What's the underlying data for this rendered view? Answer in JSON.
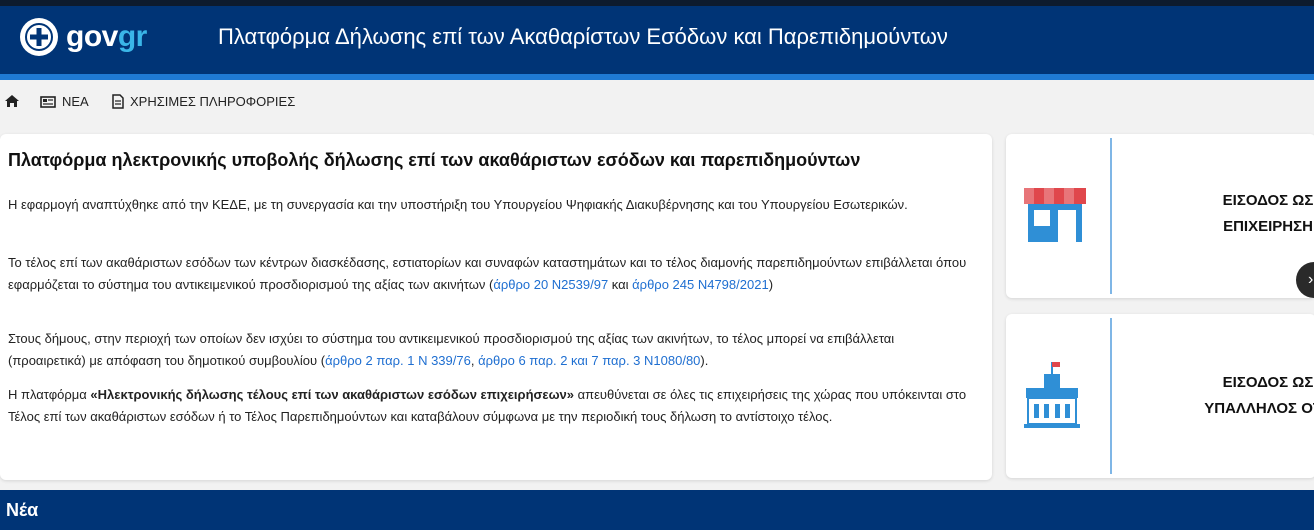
{
  "header": {
    "logo_prefix": "gov",
    "logo_suffix": "gr",
    "title": "Πλατφόρμα Δήλωσης επί των Ακαθαρίστων Εσόδων και Παρεπιδημούντων"
  },
  "nav": {
    "home_icon": "home-icon",
    "news_label": "ΝΕΑ",
    "info_label": "ΧΡΗΣΙΜΕΣ ΠΛΗΡΟΦΟΡΙΕΣ"
  },
  "main": {
    "heading": "Πλατφόρμα ηλεκτρονικής υποβολής δήλωσης επί των ακαθάριστων εσόδων και παρεπιδημούντων",
    "p1": "Η εφαρμογή αναπτύχθηκε από την ΚΕΔΕ, με τη συνεργασία και την υποστήριξη του Υπουργείου Ψηφιακής Διακυβέρνησης και του Υπουργείου Εσωτερικών.",
    "p2_text": "Το τέλος επί των ακαθάριστων εσόδων των κέντρων διασκέδασης, εστιατορίων και συναφών καταστημάτων και το τέλος διαμονής παρεπιδημούντων επιβάλλεται όπου εφαρμόζεται το σύστημα του αντικειμενικού προσδιορισμού της αξίας των ακινήτων (",
    "p2_link1": "άρθρο 20 Ν2539/97",
    "p2_mid": " και ",
    "p2_link2": "άρθρο 245 Ν4798/2021",
    "p2_end": ")",
    "p3_text": "Στους δήμους, στην περιοχή των οποίων δεν ισχύει το σύστημα του αντικειμενικού προσδιορισμού της αξίας των ακινήτων, το τέλος μπορεί να επιβάλλεται (προαιρετικά) με απόφαση του δημοτικού συμβουλίου (",
    "p3_link1": "άρθρο 2 παρ. 1 Ν 339/76",
    "p3_mid": ", ",
    "p3_link2": "άρθρο 6 παρ. 2 και 7 παρ. 3 Ν1080/80",
    "p3_end": ").",
    "p4_start": "Η πλατφόρμα ",
    "p4_bold": "«Ηλεκτρονικής δήλωσης τέλους επί των ακαθάριστων εσόδων επιχειρήσεων»",
    "p4_end": " απευθύνεται σε όλες τις επιχειρήσεις της χώρας που υπόκεινται στο Τέλος επί των ακαθάριστων εσόδων ή το Τέλος Παρεπιδημούντων και καταβάλουν σύμφωνα με την περιοδική τους δήλωση το αντίστοιχο τέλος."
  },
  "login": {
    "business_line1": "ΕΙΣΟΔΟΣ ΩΣ",
    "business_line2": "ΕΠΙΧΕΙΡΗΣΗ",
    "business_icon": "storefront-icon",
    "employee_line1": "ΕΙΣΟΔΟΣ ΩΣ",
    "employee_line2": "ΥΠΑΛΛΗΛΟΣ ΟΤΑ",
    "employee_icon": "town-hall-icon"
  },
  "news_section": {
    "title": "Νέα"
  },
  "colors": {
    "header_bg": "#003476",
    "accent_bar": "#1f7ad4",
    "link": "#1f6fd1",
    "logo_gr": "#3ab6e8"
  }
}
